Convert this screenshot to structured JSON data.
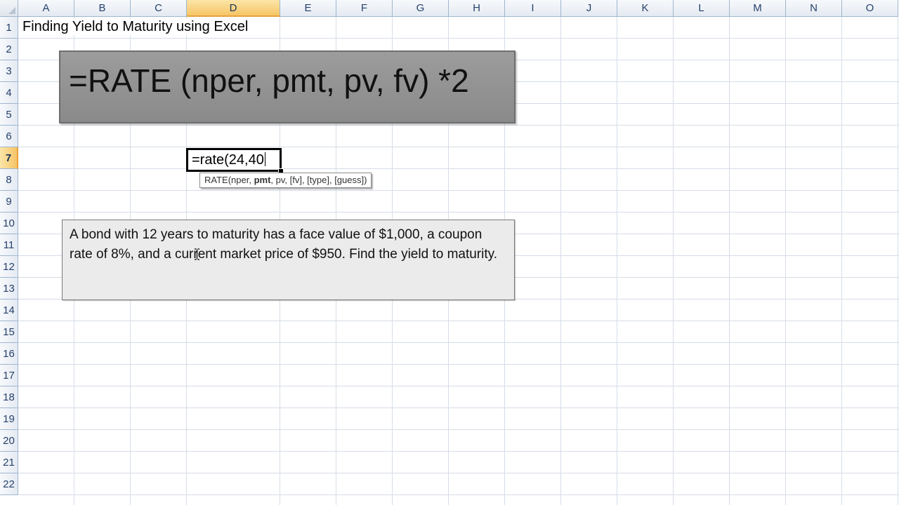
{
  "sheet": {
    "columns": [
      "A",
      "B",
      "C",
      "D",
      "E",
      "F",
      "G",
      "H",
      "I",
      "J",
      "K",
      "L",
      "M",
      "N",
      "O"
    ],
    "rows": [
      "1",
      "2",
      "3",
      "4",
      "5",
      "6",
      "7",
      "8",
      "9",
      "10",
      "11",
      "12",
      "13",
      "14",
      "15",
      "16",
      "17",
      "18",
      "19",
      "20",
      "21",
      "22"
    ],
    "active_column": "D",
    "active_row": "7"
  },
  "cells": {
    "A1": "Finding Yield to Maturity using Excel"
  },
  "formula_box": {
    "text": "=RATE (nper, pmt, pv, fv) *2"
  },
  "active_cell": {
    "value": "=rate(24,40"
  },
  "tooltip": {
    "prefix": "RATE(nper, ",
    "current_arg": "pmt",
    "suffix": ", pv, [fv], [type], [guess])"
  },
  "problem_box": {
    "text": "A bond with 12 years to maturity has a face value of $1,000, a coupon rate of 8%, and a current market price of $950. Find the yield to maturity."
  },
  "colors": {
    "header_bg": "#e4eaf2",
    "header_active": "#f6c566",
    "gridline": "#d6dde8",
    "formula_box_bg": "#9c9c9c",
    "problem_box_bg": "#ebebeb"
  }
}
